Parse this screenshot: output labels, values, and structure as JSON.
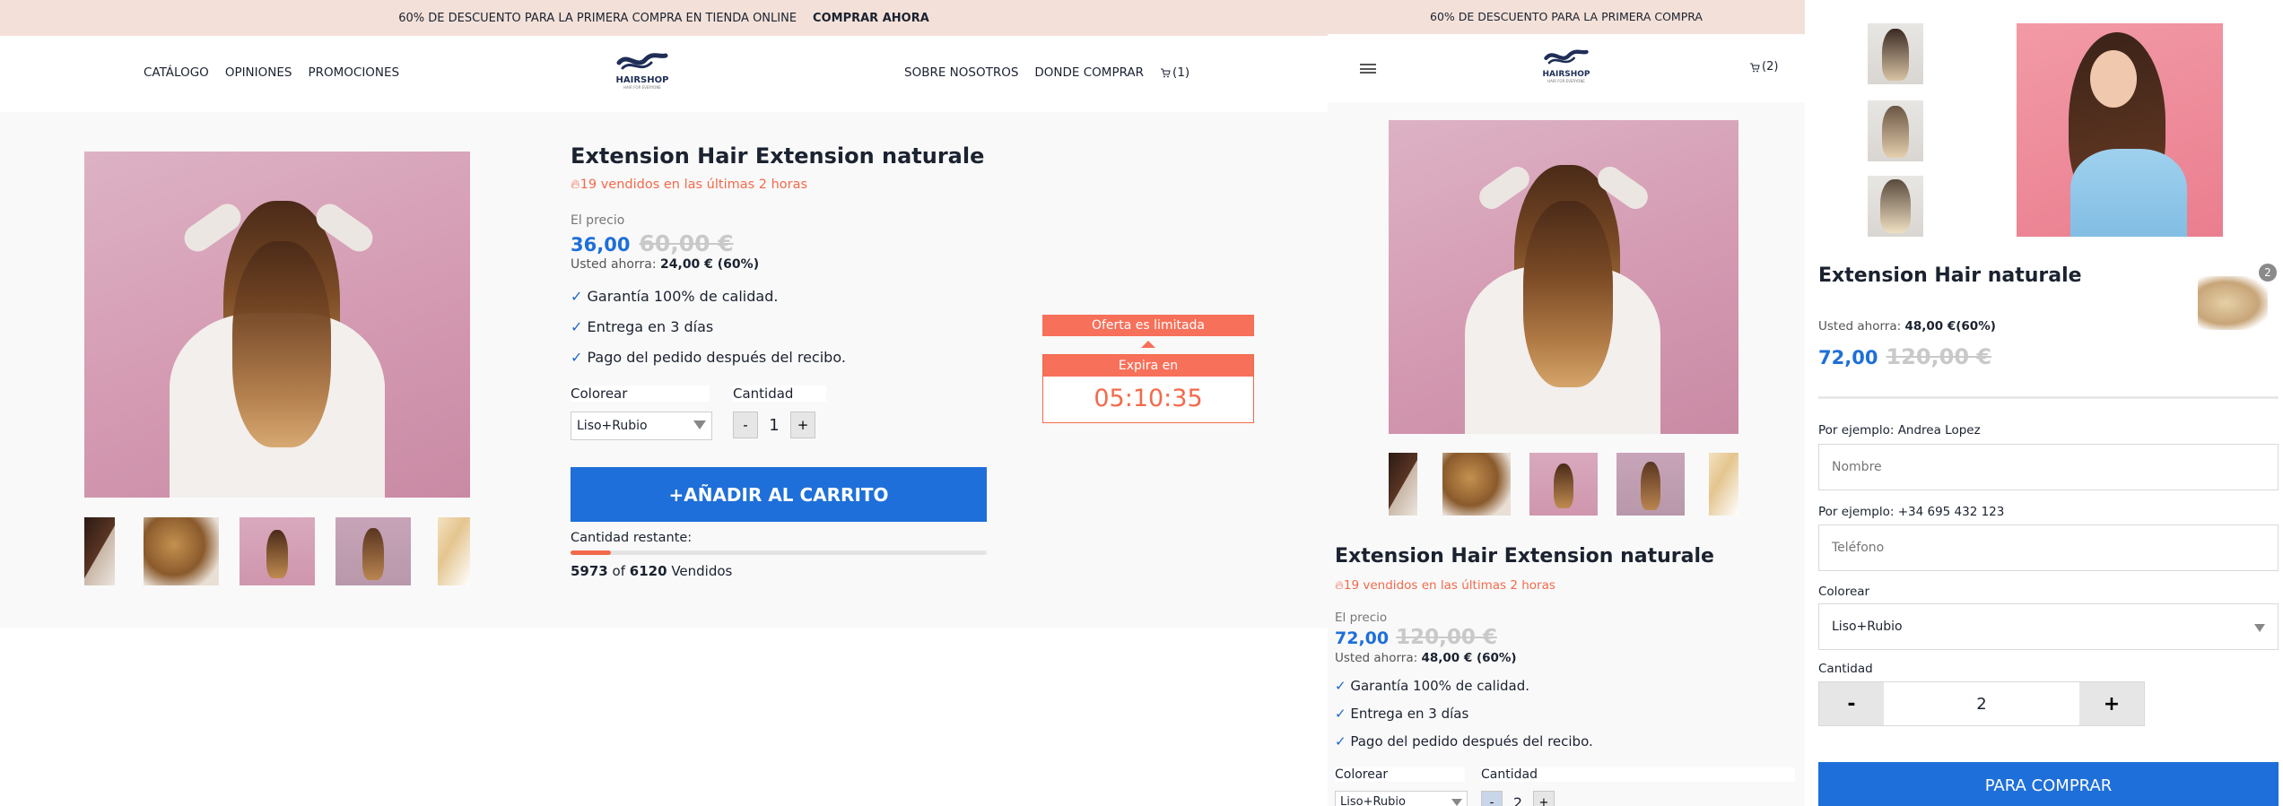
{
  "desktop": {
    "announcement": {
      "text": "60% DE DESCUENTO PARA LA PRIMERA COMPRA EN TIENDA ONLINE",
      "cta": "COMPRAR AHORA"
    },
    "nav_left": [
      "CATÁLOGO",
      "OPINIONES",
      "PROMOCIONES"
    ],
    "nav_right": [
      "SOBRE NOSOTROS",
      "DONDE COMPRAR"
    ],
    "cart_count": "(1)",
    "logo": {
      "name": "HAIRSHOP",
      "tagline": "HAIR FOR EVERYONE"
    },
    "product": {
      "title": "Extension Hair Extension naturale",
      "sold_recent": "19 vendidos en las últimas 2 horas",
      "price_label": "El precio",
      "price": "36,00",
      "old_price": "60,00 €",
      "savings_label": "Usted ahorra:",
      "savings_value": "24,00 € (60%)",
      "features": [
        "Garantía 100% de calidad.",
        "Entrega en 3 días",
        "Pago del pedido después del recibo."
      ],
      "color_label": "Colorear",
      "color_value": "Liso+Rubio",
      "qty_label": "Cantidad",
      "qty_minus": "-",
      "qty_value": "1",
      "qty_plus": "+",
      "add_to_cart": "+AÑADIR AL CARRITO",
      "remaining_label": "Cantidad restante:",
      "remaining_fraction": 0.0977,
      "sold_count": "5973",
      "sold_of": "of",
      "sold_total": "6120",
      "sold_suffix": "Vendidos"
    },
    "offer": {
      "label": "Oferta es limitada",
      "expires": "Expira en",
      "timer": "05:10:35"
    }
  },
  "mobile": {
    "announcement": "60% DE DESCUENTO PARA LA PRIMERA COMPRA",
    "cart_count": "(2)",
    "logo": {
      "name": "HAIRSHOP",
      "tagline": "HAIR FOR EVERYONE"
    },
    "product": {
      "title": "Extension Hair Extension naturale",
      "sold_recent": "19 vendidos en las últimas 2 horas",
      "price_label": "El precio",
      "price": "72,00",
      "old_price": "120,00 €",
      "savings_label": "Usted ahorra:",
      "savings_value": "48,00 € (60%)",
      "features": [
        "Garantía 100% de calidad.",
        "Entrega en 3 días",
        "Pago del pedido después del recibo."
      ],
      "color_label": "Colorear",
      "color_value": "Liso+Rubio",
      "qty_label": "Cantidad",
      "qty_minus": "-",
      "qty_value": "2",
      "qty_plus": "+"
    }
  },
  "checkout": {
    "title": "Extension Hair naturale",
    "badge_count": "2",
    "savings_label": "Usted ahorra:",
    "savings_value": "48,00 €(60%)",
    "price": "72,00",
    "old_price": "120,00 €",
    "name_hint": "Por ejemplo: Andrea Lopez",
    "name_placeholder": "Nombre",
    "phone_hint": "Por ejemplo: +34 695 432 123",
    "phone_placeholder": "Teléfono",
    "color_label": "Colorear",
    "color_value": "Liso+Rubio",
    "qty_label": "Cantidad",
    "qty_minus": "-",
    "qty_value": "2",
    "qty_plus": "+",
    "submit": "PARA COMPRAR"
  },
  "colors": {
    "accent_blue": "#1e6fd9",
    "sale_orange": "#f26a4b",
    "announce_bg": "#f3e1d9",
    "panel_bg": "#f9f9f9"
  }
}
